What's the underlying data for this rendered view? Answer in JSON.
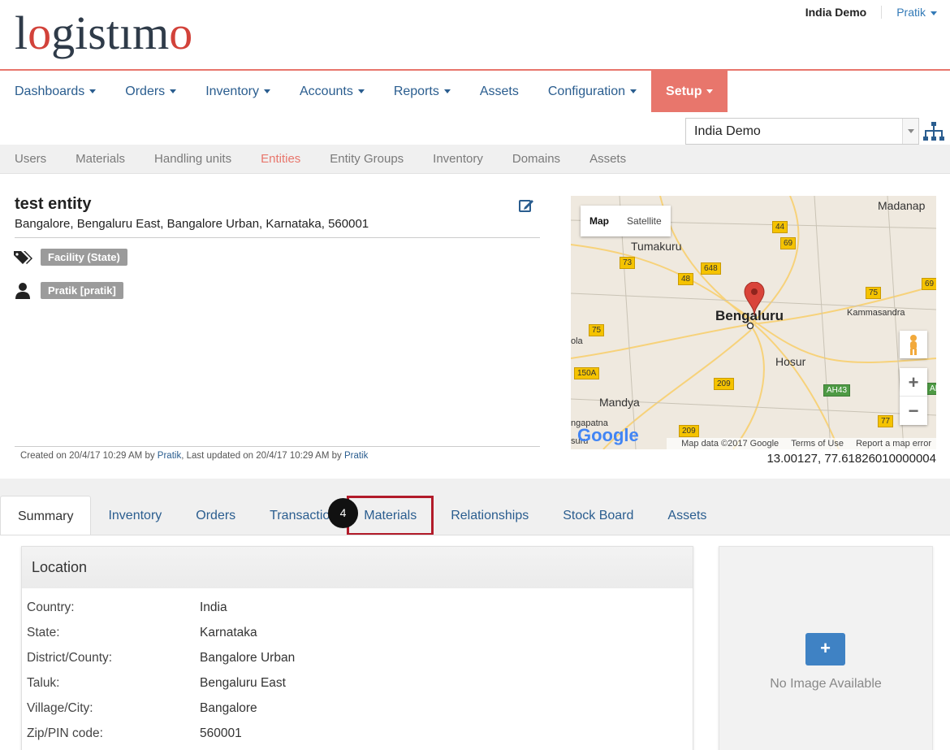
{
  "brand": {
    "logo_text_a": "lo",
    "logo_text_b": "gistımo",
    "accent": "#e8766c"
  },
  "header": {
    "domain": "India Demo",
    "user": "Pratik"
  },
  "main_nav": [
    {
      "label": "Dashboards",
      "caret": true
    },
    {
      "label": "Orders",
      "caret": true
    },
    {
      "label": "Inventory",
      "caret": true
    },
    {
      "label": "Accounts",
      "caret": true
    },
    {
      "label": "Reports",
      "caret": true
    },
    {
      "label": "Assets",
      "caret": false
    },
    {
      "label": "Configuration",
      "caret": true
    },
    {
      "label": "Setup",
      "caret": true,
      "active": true
    }
  ],
  "domain_select": {
    "value": "India Demo"
  },
  "sub_nav": [
    "Users",
    "Materials",
    "Handling units",
    "Entities",
    "Entity Groups",
    "Inventory",
    "Domains",
    "Assets"
  ],
  "sub_nav_active": "Entities",
  "entity": {
    "name": "test entity",
    "address": "Bangalore, Bengaluru East, Bangalore Urban, Karnataka, 560001",
    "tag": "Facility (State)",
    "user": "Pratik [pratik]",
    "created_prefix": "Created on 20/4/17 10:29 AM by ",
    "created_by": "Pratik",
    "updated_prefix": ", Last updated on 20/4/17 10:29 AM by ",
    "updated_by": "Pratik",
    "coords": "13.00127, 77.61826010000004"
  },
  "map": {
    "tab_map": "Map",
    "tab_satellite": "Satellite",
    "city": "Bengaluru",
    "places": [
      "Tumakuru",
      "Madanap",
      "Kammasandra",
      "Hosur",
      "Mandya",
      "ola",
      "ngapatna",
      "suru"
    ],
    "shields": [
      "44",
      "69",
      "73",
      "648",
      "48",
      "75",
      "69",
      "75",
      "150A",
      "209",
      "AH43",
      "77",
      "209",
      "AH"
    ],
    "zoom_in": "+",
    "zoom_out": "−",
    "google": "Google",
    "map_data": "Map data ©2017 Google",
    "terms": "Terms of Use",
    "report": "Report a map error"
  },
  "tabs": [
    "Summary",
    "Inventory",
    "Orders",
    "Transactio",
    "Materials",
    "Relationships",
    "Stock Board",
    "Assets"
  ],
  "tabs_active": "Summary",
  "tabs_highlight": "Materials",
  "step_badge": "4",
  "location": {
    "title": "Location",
    "rows": [
      {
        "k": "Country:",
        "v": "India"
      },
      {
        "k": "State:",
        "v": "Karnataka"
      },
      {
        "k": "District/County:",
        "v": "Bangalore Urban"
      },
      {
        "k": "Taluk:",
        "v": "Bengaluru East"
      },
      {
        "k": "Village/City:",
        "v": "Bangalore"
      },
      {
        "k": "Zip/PIN code:",
        "v": "560001"
      }
    ]
  },
  "image_panel": {
    "add": "+",
    "empty": "No Image Available"
  }
}
